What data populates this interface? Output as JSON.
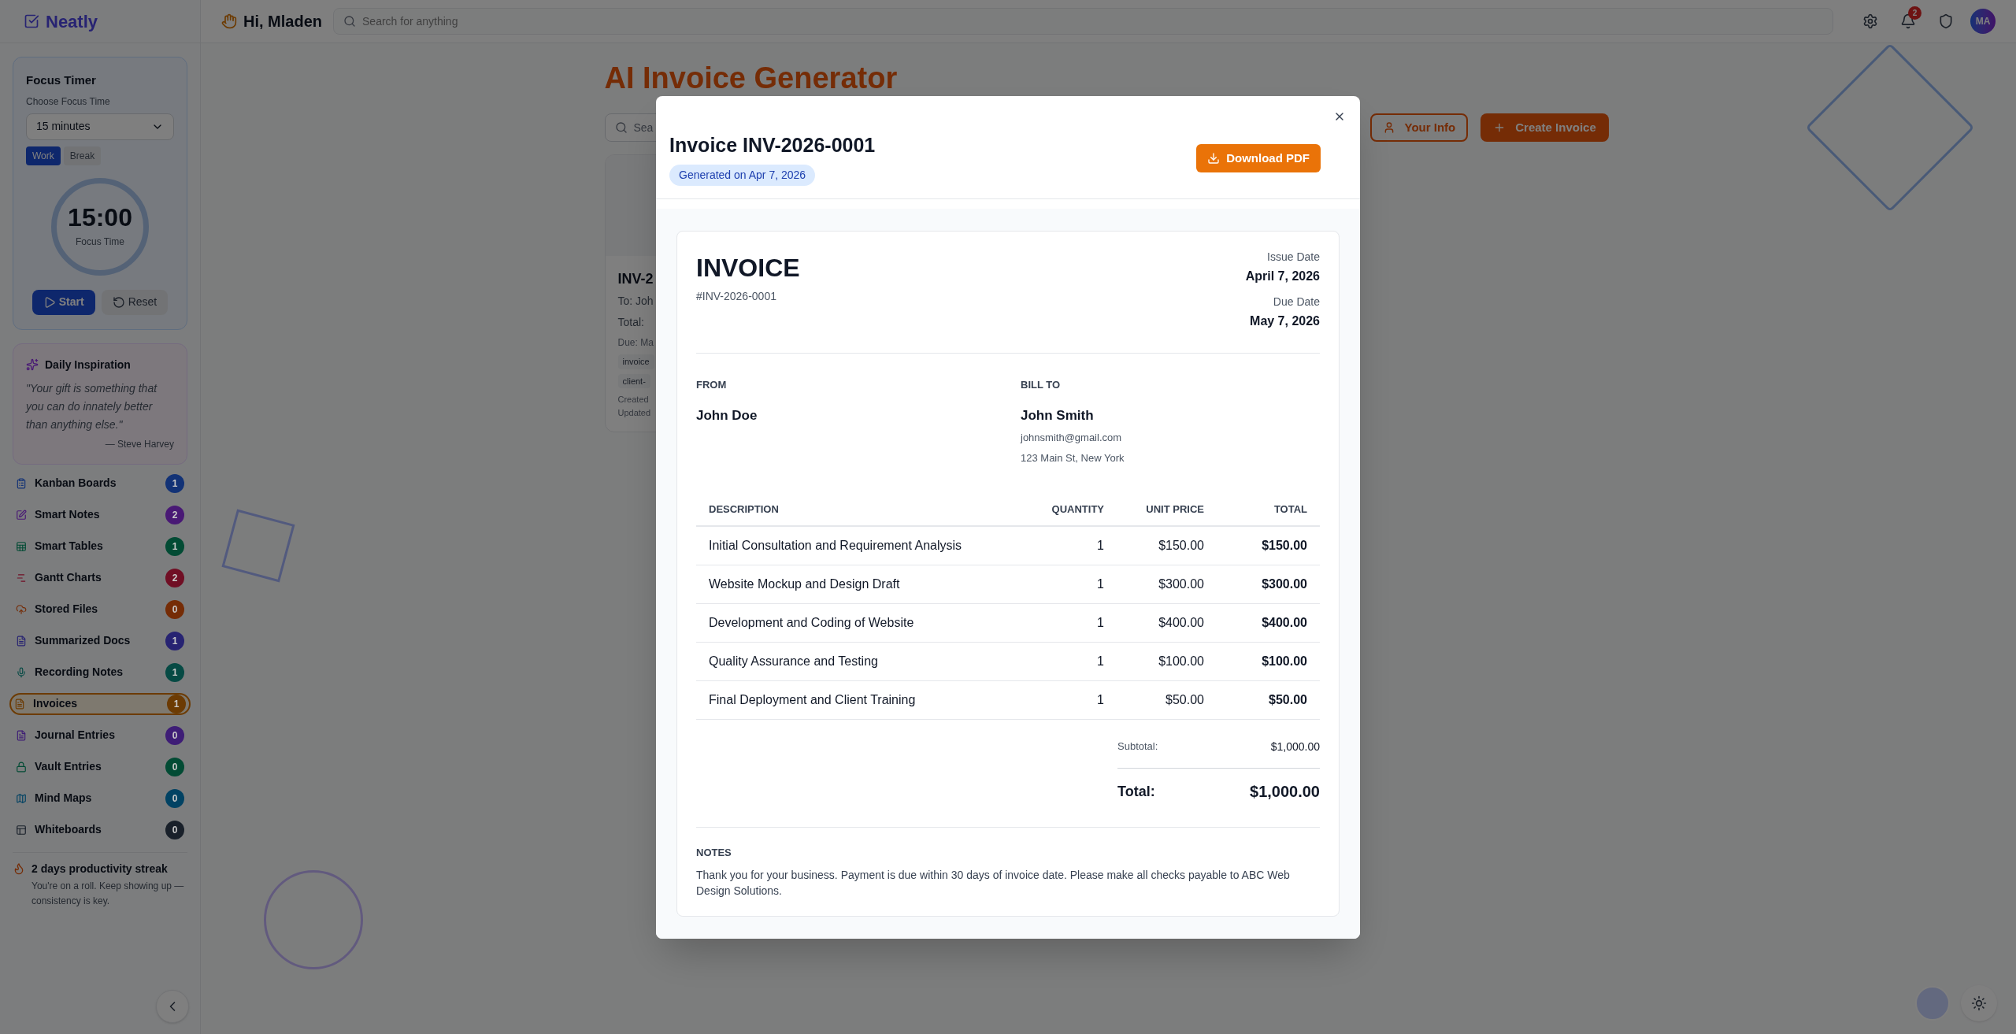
{
  "sidebar": {
    "brand": "Neatly",
    "focus_timer": {
      "title": "Focus Timer",
      "label": "Choose Focus Time",
      "duration": "15 minutes",
      "modes": [
        {
          "label": "Work",
          "selected": true
        },
        {
          "label": "Break",
          "selected": false
        }
      ],
      "time": "15:00",
      "caption": "Focus Time",
      "start": "Start",
      "reset": "Reset"
    },
    "inspiration": {
      "title": "Daily Inspiration",
      "quote": "\"Your gift is something that you can do innately better than anything else.\"",
      "author": "— Steve Harvey"
    },
    "items": [
      {
        "kind": "clipboard",
        "label": "Kanban Boards",
        "count": "1",
        "color": "#123276",
        "selected": false
      },
      {
        "kind": "pen",
        "label": "Smart Notes",
        "count": "2",
        "color": "#491975",
        "selected": false
      },
      {
        "kind": "table",
        "label": "Smart Tables",
        "count": "1",
        "color": "#024b34",
        "selected": false
      },
      {
        "kind": "chart",
        "label": "Gantt Charts",
        "count": "2",
        "color": "#700e24",
        "selected": false
      },
      {
        "kind": "upload",
        "label": "Stored Files",
        "count": "0",
        "color": "#752c06",
        "selected": false
      },
      {
        "kind": "doc",
        "label": "Summarized Docs",
        "count": "1",
        "color": "#272372",
        "selected": false
      },
      {
        "kind": "mic",
        "label": "Recording Notes",
        "count": "1",
        "color": "#064a44",
        "selected": false
      },
      {
        "kind": "doc",
        "label": "Invoices",
        "count": "1",
        "color": "#6c3b03",
        "selected": true
      },
      {
        "kind": "doc",
        "label": "Journal Entries",
        "count": "0",
        "color": "#3e1d76",
        "selected": false
      },
      {
        "kind": "lock",
        "label": "Vault Entries",
        "count": "0",
        "color": "#024b34",
        "selected": false
      },
      {
        "kind": "map",
        "label": "Mind Maps",
        "count": "0",
        "color": "#014263",
        "selected": false
      },
      {
        "kind": "board",
        "label": "Whiteboards",
        "count": "0",
        "color": "#19202a",
        "selected": false
      }
    ],
    "streak": {
      "title": "2 days productivity streak",
      "text": "You're on a roll. Keep showing up — consistency is key."
    }
  },
  "topbar": {
    "greeting": "Hi, Mladen",
    "search_placeholder": "Search for anything",
    "notifications": "2",
    "avatar": "MA"
  },
  "page": {
    "title": "AI Invoice Generator",
    "search_placeholder": "Sea",
    "your_info": "Your Info",
    "create": "Create Invoice",
    "card": {
      "title": "INV-2",
      "to": "To: Joh",
      "total": "Total:",
      "due": "Due: Ma",
      "tags": [
        "invoice",
        "client-"
      ],
      "created": "Created",
      "updated": "Updated"
    }
  },
  "modal": {
    "title": "Invoice INV-2026-0001",
    "badge": "Generated on Apr 7, 2026",
    "download": "Download PDF",
    "invoice": {
      "heading": "INVOICE",
      "number": "#INV-2026-0001",
      "dates": [
        {
          "label": "Issue Date",
          "value": "April 7, 2026"
        },
        {
          "label": "Due Date",
          "value": "May 7, 2026"
        }
      ],
      "from": {
        "label": "FROM",
        "name": "John Doe"
      },
      "bill_to": {
        "label": "BILL TO",
        "name": "John Smith",
        "lines": [
          "johnsmith@gmail.com",
          "123 Main St, New York"
        ]
      },
      "columns": [
        "DESCRIPTION",
        "QUANTITY",
        "UNIT PRICE",
        "TOTAL"
      ],
      "rows": [
        [
          "Initial Consultation and Requirement Analysis",
          "1",
          "$150.00",
          "$150.00"
        ],
        [
          "Website Mockup and Design Draft",
          "1",
          "$300.00",
          "$300.00"
        ],
        [
          "Development and Coding of Website",
          "1",
          "$400.00",
          "$400.00"
        ],
        [
          "Quality Assurance and Testing",
          "1",
          "$100.00",
          "$100.00"
        ],
        [
          "Final Deployment and Client Training",
          "1",
          "$50.00",
          "$50.00"
        ]
      ],
      "subtotal": {
        "label": "Subtotal:",
        "value": "$1,000.00"
      },
      "total": {
        "label": "Total:",
        "value": "$1,000.00"
      },
      "notes": {
        "label": "NOTES",
        "text": "Thank you for your business. Payment is due within 30 days of invoice date. Please make all checks payable to ABC Web Design Solutions."
      }
    }
  }
}
